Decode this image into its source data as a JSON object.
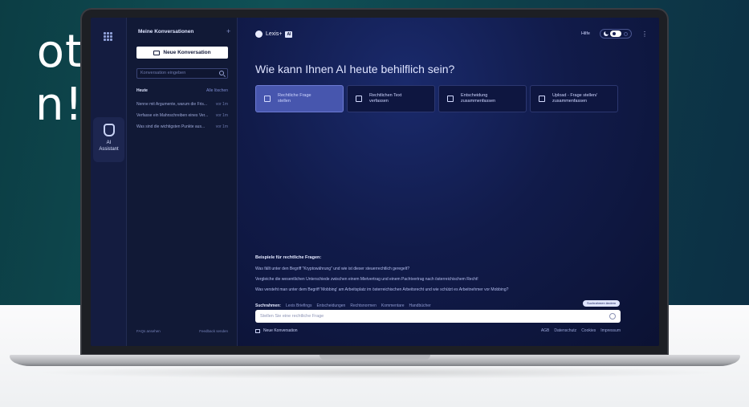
{
  "promo": {
    "line1": "ot",
    "line2": "n!"
  },
  "rail": {
    "assistant_label_1": "AI",
    "assistant_label_2": "Assistant"
  },
  "sidebar": {
    "title": "Meine Konversationen",
    "new_button": "Neue Konversation",
    "search_placeholder": "Konversation eingeben",
    "section_today": "Heute",
    "delete_all": "Alle löschen",
    "conversations": [
      {
        "title": "Nenne mit Argumente, warum die Fris...",
        "age": "vor 1m"
      },
      {
        "title": "Verfasse ein Mahnschreiben eines Ver...",
        "age": "vor 1m"
      },
      {
        "title": "Was sind die wichtigsten Punkte aus...",
        "age": "vor 1m"
      }
    ],
    "footer_faq": "FAQs ansehen",
    "footer_feedback": "Feedback senden"
  },
  "header": {
    "brand": "Lexis+",
    "brand_badge": "AI",
    "help": "Hilfe"
  },
  "main": {
    "heading": "Wie kann Ihnen AI heute behilflich sein?",
    "cards": [
      {
        "line1": "Rechtliche Frage",
        "line2": "stellen"
      },
      {
        "line1": "Rechtlichen Text",
        "line2": "verfassen"
      },
      {
        "line1": "Entscheidung",
        "line2": "zusammenfassen"
      },
      {
        "line1": "Upload - Frage stellen/",
        "line2": "zusammenfassen"
      }
    ],
    "examples_title": "Beispiele für rechtliche Fragen:",
    "examples": [
      "Was fällt unter den Begriff \"Kryptowährung\" und wie ist dieser steuerrechtlich geregelt?",
      "Vergleiche die wesentlichen Unterschiede zwischen einem Mietvertrag und einem Pachtvertrag nach österreichischem Recht!",
      "Was versteht man unter dem Begriff 'Mobbing' am Arbeitsplatz im österreichischen Arbeitsrecht und wie schützt es Arbeitnehmer vor Mobbing?"
    ],
    "scope_label": "Suchrahmen:",
    "scope_items": [
      "Lexis Briefings",
      "Entscheidungen",
      "Rechtsnormen",
      "Kommentare",
      "Handbücher"
    ],
    "scope_button": "Suchrahmen ändern",
    "prompt_placeholder": "Stellen Sie eine rechtliche Frage",
    "new_conversation": "Neue Konversation",
    "legal": [
      "AGB",
      "Datenschutz",
      "Cookies",
      "Impressum"
    ]
  },
  "colors": {
    "accent": "#4756ae",
    "background": "#0d1535"
  }
}
